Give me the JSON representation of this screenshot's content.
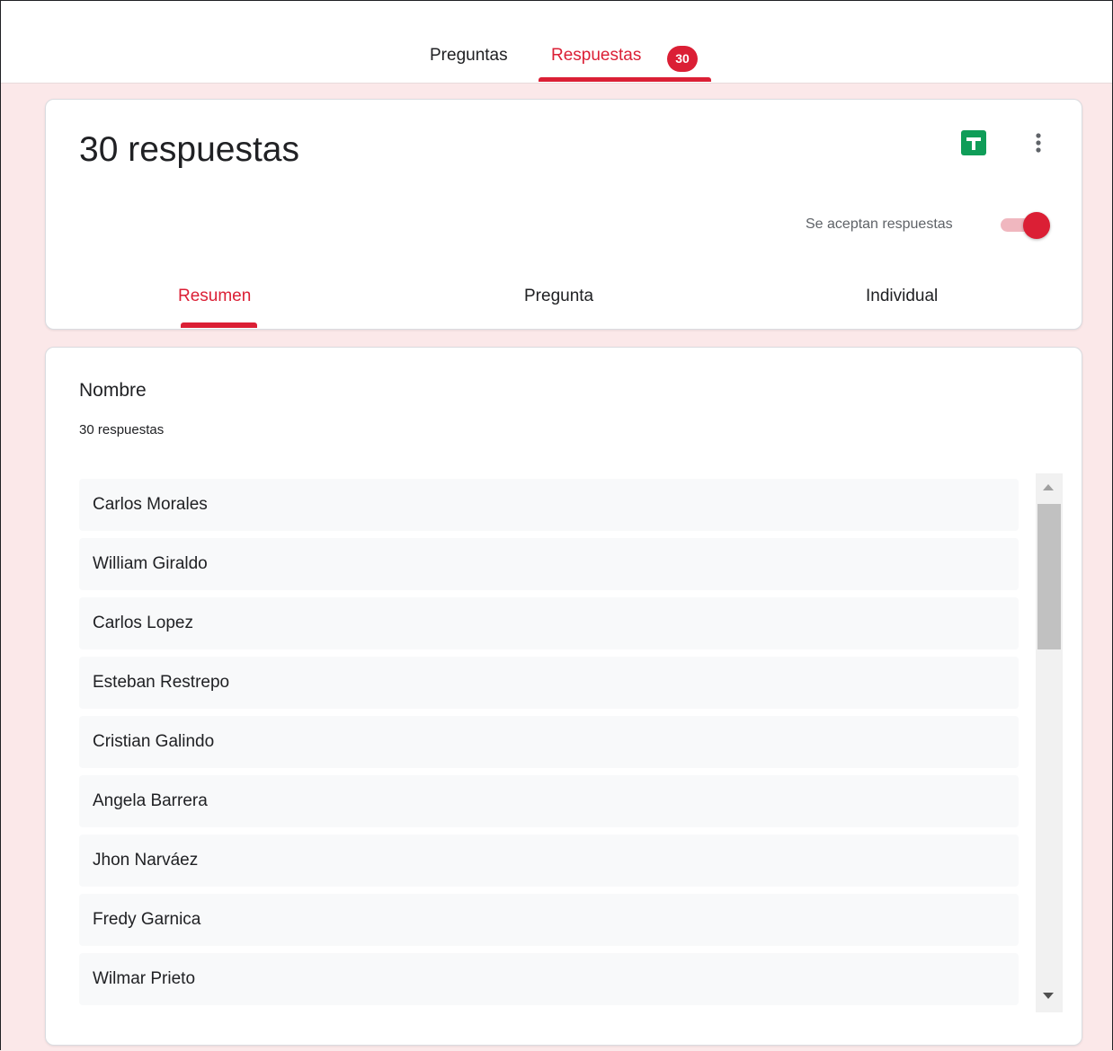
{
  "tabs": {
    "questions": "Preguntas",
    "responses": "Respuestas",
    "responses_badge": "30"
  },
  "summary_card": {
    "title": "30 respuestas",
    "accepting_label": "Se aceptan respuestas",
    "accepting_on": true,
    "accent_color": "#db1f35",
    "sheets_icon_color": "#0f9d58",
    "subtabs": [
      "Resumen",
      "Pregunta",
      "Individual"
    ],
    "active_subtab": "Resumen"
  },
  "question": {
    "title": "Nombre",
    "count_label": "30 respuestas",
    "answers": [
      "Carlos Morales",
      "William Giraldo",
      "Carlos Lopez",
      "Esteban Restrepo",
      "Cristian Galindo",
      "Angela Barrera",
      "Jhon Narváez",
      "Fredy Garnica",
      "Wilmar Prieto"
    ]
  }
}
